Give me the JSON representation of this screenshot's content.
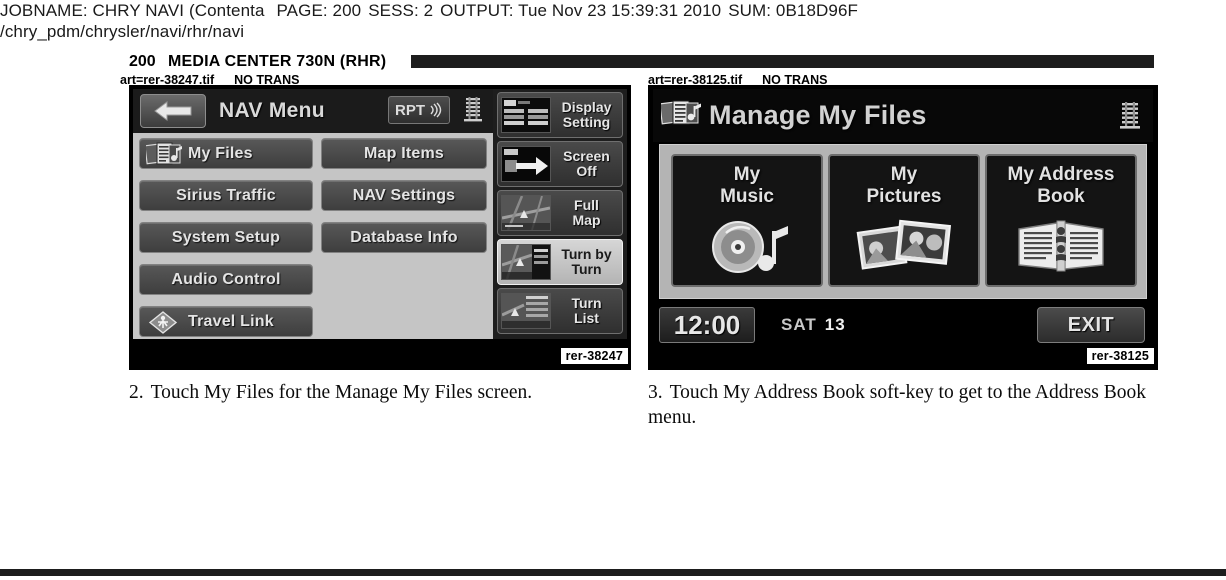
{
  "job_header": {
    "line1_parts": [
      "JOBNAME: CHRY NAVI (Contenta",
      "PAGE: 200",
      "SESS: 2",
      "OUTPUT: Tue Nov 23 15:39:31 2010",
      "SUM: 0B18D96F"
    ],
    "line2": "/chry_pdm/chrysler/navi/rhr/navi"
  },
  "page_id": {
    "number": "200",
    "title": "MEDIA CENTER 730N (RHR)"
  },
  "art_labels": {
    "left_file": "art=rer-38247.tif",
    "left_trans": "NO TRANS",
    "right_file": "art=rer-38125.tif",
    "right_trans": "NO TRANS"
  },
  "left_screen": {
    "caption_tag": "rer-38247",
    "back_icon": "back-arrow-icon",
    "title": "NAV Menu",
    "rpt_label": "RPT",
    "rpt_icon": "sound-wave-icon",
    "equalizer_icon": "equalizer-icon",
    "menu_buttons": [
      {
        "label": "My Files",
        "icon": "media-files-icon",
        "col": 1,
        "row": 1
      },
      {
        "label": "Map Items",
        "icon": null,
        "col": 2,
        "row": 1
      },
      {
        "label": "Sirius Traffic",
        "icon": null,
        "col": 1,
        "row": 2
      },
      {
        "label": "NAV Settings",
        "icon": null,
        "col": 2,
        "row": 2
      },
      {
        "label": "System Setup",
        "icon": null,
        "col": 1,
        "row": 3
      },
      {
        "label": "Database Info",
        "icon": null,
        "col": 2,
        "row": 3
      },
      {
        "label": "Audio Control",
        "icon": null,
        "col": 1,
        "row": 4
      },
      {
        "label": "Travel Link",
        "icon": "travel-link-icon",
        "col": 1,
        "row": 5
      }
    ],
    "soft_keys": [
      {
        "line1": "Display",
        "line2": "Setting",
        "icon": "display-setting-icon",
        "active": false
      },
      {
        "line1": "Screen",
        "line2": "Off",
        "icon": "screen-off-icon",
        "active": false
      },
      {
        "line1": "Full",
        "line2": "Map",
        "icon": "full-map-icon",
        "active": false
      },
      {
        "line1": "Turn by",
        "line2": "Turn",
        "icon": "turn-by-turn-icon",
        "active": true
      },
      {
        "line1": "Turn",
        "line2": "List",
        "icon": "turn-list-icon",
        "active": false
      }
    ]
  },
  "right_screen": {
    "caption_tag": "rer-38125",
    "title": "Manage My Files",
    "title_icon": "media-files-icon",
    "equalizer_icon": "equalizer-icon",
    "tiles": [
      {
        "line1": "My",
        "line2": "Music",
        "icon": "cd-music-note-icon"
      },
      {
        "line1": "My",
        "line2": "Pictures",
        "icon": "photos-icon"
      },
      {
        "line1": "My Address",
        "line2": "Book",
        "icon": "open-address-book-icon"
      }
    ],
    "status_bar": {
      "clock": "12:00",
      "day": "SAT",
      "date": "13",
      "exit_label": "EXIT"
    }
  },
  "body": {
    "step2_number": "2.",
    "step2_text": "Touch My Files for the Manage My Files screen.",
    "step3_number": "3.",
    "step3_text": "Touch My Address Book soft-key to get to the Address Book menu."
  },
  "colors": {
    "page_background": "#ffffff",
    "rule_black": "#1d1d1d",
    "screen_black": "#000000",
    "panel_gray": "#c5c5c5",
    "button_gray": "#4a4a4a",
    "active_key": "#d6d6d6"
  }
}
